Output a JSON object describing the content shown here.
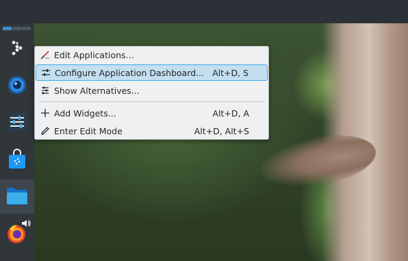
{
  "menu": {
    "items": [
      {
        "label": "Edit Applications…",
        "shortcut": "",
        "icon": "edit-applications-icon"
      },
      {
        "label": "Configure Application Dashboard...",
        "shortcut": "Alt+D, S",
        "icon": "configure-sliders-icon",
        "highlighted": true
      },
      {
        "label": "Show Alternatives...",
        "shortcut": "",
        "icon": "alternatives-icon"
      },
      {
        "label": "Add Widgets...",
        "shortcut": "Alt+D, A",
        "icon": "plus-icon"
      },
      {
        "label": "Enter Edit Mode",
        "shortcut": "Alt+D, Alt+S",
        "icon": "pencil-icon"
      }
    ]
  },
  "panel": {
    "launchers": [
      {
        "name": "application-dashboard-launcher",
        "icon": "dashboard-dots-icon"
      },
      {
        "name": "browser-launcher",
        "icon": "globe-icon"
      },
      {
        "name": "system-settings-launcher",
        "icon": "settings-sliders-icon"
      },
      {
        "name": "discover-store-launcher",
        "icon": "store-bag-icon"
      },
      {
        "name": "file-manager-launcher",
        "icon": "folder-icon"
      },
      {
        "name": "firefox-launcher",
        "icon": "firefox-icon",
        "badge": "speaker-icon"
      }
    ]
  },
  "colors": {
    "highlight_bg": "#c3dff0",
    "highlight_border": "#3daee9",
    "panel_bg": "#31363b",
    "menu_bg": "#eff0f1"
  }
}
